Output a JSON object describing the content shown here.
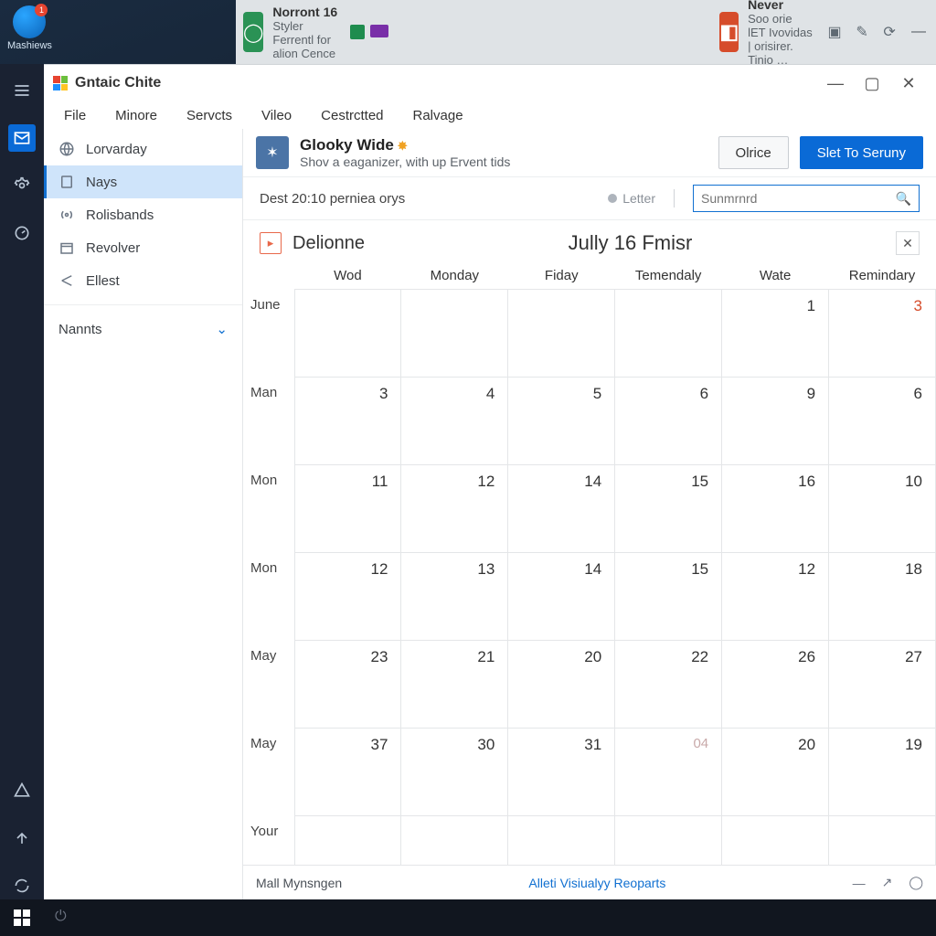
{
  "desktop": {
    "icon_label": "Mashiews",
    "badge": "1"
  },
  "topbar": {
    "tile1": {
      "title": "Norront 16",
      "sub": "Styler Ferrentl for alion Cence"
    },
    "tile2": {
      "title": "Never",
      "sub": "Soo orie lET Ivovidas | orisirer. Tinio …"
    }
  },
  "app": {
    "title": "Gntaic Chite",
    "menu": [
      "File",
      "Minore",
      "Servcts",
      "Vileo",
      "Cestrctted",
      "Ralvage"
    ],
    "sidebar": {
      "items": [
        {
          "label": "Lorvarday"
        },
        {
          "label": "Nays"
        },
        {
          "label": "Rolisbands"
        },
        {
          "label": "Revolver"
        },
        {
          "label": "Ellest"
        }
      ],
      "section": "Nannts"
    },
    "ribbon": {
      "title": "Glooky Wide",
      "sub": "Shov a eaganizer, with up Ervent tids",
      "btn1": "Olrice",
      "btn2": "Slet To Seruny"
    },
    "infobar": {
      "text": "Dest 20:10 perniea orys",
      "pill": "Letter",
      "search_placeholder": "Sunmrnrd"
    },
    "cal": {
      "label": "Delionne",
      "month": "Jully 16 Fmisr",
      "cols": [
        "Wod",
        "Monday",
        "Fiday",
        "Temendaly",
        "Wate",
        "Remindary"
      ],
      "rows": [
        {
          "h": "June",
          "c": [
            "",
            "",
            "",
            "",
            "1",
            "3"
          ],
          "flags": [
            "",
            "",
            "",
            "",
            "",
            "red"
          ]
        },
        {
          "h": "Man",
          "c": [
            "3",
            "4",
            "5",
            "6",
            "9",
            "6"
          ]
        },
        {
          "h": "Mon",
          "c": [
            "11",
            "12",
            "14",
            "15",
            "16",
            "10"
          ]
        },
        {
          "h": "Mon",
          "c": [
            "12",
            "13",
            "14",
            "15",
            "12",
            "18"
          ]
        },
        {
          "h": "May",
          "c": [
            "23",
            "21",
            "20",
            "22",
            "26",
            "27"
          ]
        },
        {
          "h": "May",
          "c": [
            "37",
            "30",
            "31",
            "04",
            "20",
            "19"
          ],
          "flags": [
            "",
            "",
            "",
            "faint",
            "",
            ""
          ]
        },
        {
          "h": "Your",
          "c": [
            "",
            "",
            "",
            "",
            "",
            ""
          ]
        }
      ]
    },
    "status": {
      "left": "Mall Mynsngen",
      "mid": "Alleti Visiualyy Reoparts"
    }
  }
}
